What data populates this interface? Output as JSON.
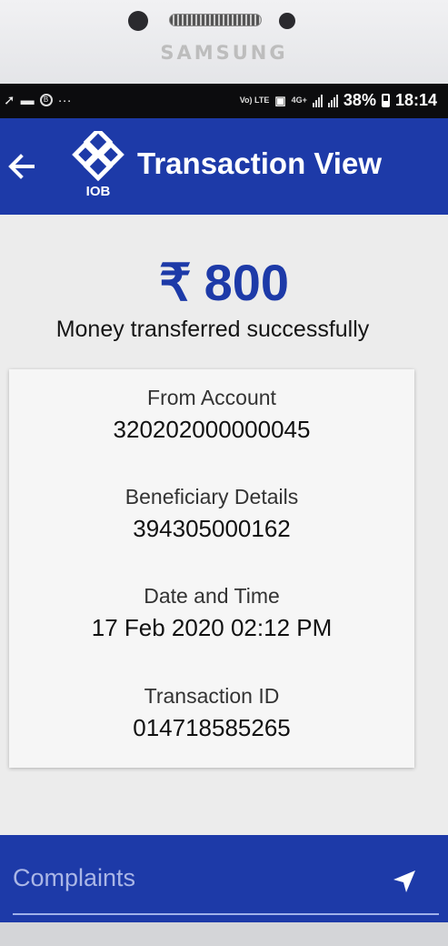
{
  "device": {
    "brand": "SAMSUNG"
  },
  "status_bar": {
    "left_icons": [
      "signal-icon",
      "chat-icon",
      "b-icon",
      "more-icon"
    ],
    "net_label": "Vo) LTE",
    "net_type": "4G+",
    "battery": "38%",
    "time": "18:14"
  },
  "header": {
    "title": "Transaction View",
    "logo_text": "IOB"
  },
  "transaction": {
    "currency_symbol": "₹",
    "amount": "800",
    "status": "Money transferred successfully",
    "fields": [
      {
        "label": "From Account",
        "value": "320202000000045"
      },
      {
        "label": "Beneficiary Details",
        "value": "394305000162"
      },
      {
        "label": "Date and Time",
        "value": "17 Feb 2020 02:12 PM"
      },
      {
        "label": "Transaction ID",
        "value": "014718585265"
      }
    ]
  },
  "complaints": {
    "label": "Complaints"
  },
  "colors": {
    "primary": "#1d3aa8",
    "background": "#ececec",
    "card": "#f6f6f6"
  }
}
